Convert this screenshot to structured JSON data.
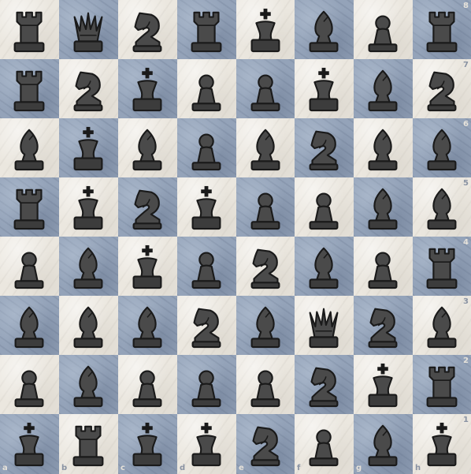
{
  "board": {
    "files": [
      "a",
      "b",
      "c",
      "d",
      "e",
      "f",
      "g",
      "h"
    ],
    "ranks": [
      "8",
      "7",
      "6",
      "5",
      "4",
      "3",
      "2",
      "1"
    ],
    "colors": {
      "light_square": "#ebe7df",
      "dark_square": "#94a3b9",
      "piece_fill": "#4a4a4a",
      "piece_outline": "#1a1a1a"
    },
    "piece_color": "black",
    "position": [
      [
        "rook",
        "queen",
        "knight",
        "rook",
        "king",
        "bishop",
        "pawn",
        "rook"
      ],
      [
        "rook",
        "knight",
        "king",
        "pawn",
        "pawn",
        "king",
        "bishop",
        "knight"
      ],
      [
        "bishop",
        "king",
        "bishop",
        "pawn",
        "bishop",
        "knight",
        "bishop",
        "bishop"
      ],
      [
        "rook",
        "king",
        "knight",
        "king",
        "pawn",
        "pawn",
        "bishop",
        "bishop"
      ],
      [
        "pawn",
        "bishop",
        "king",
        "pawn",
        "knight",
        "bishop",
        "pawn",
        "rook"
      ],
      [
        "bishop",
        "bishop",
        "bishop",
        "knight",
        "bishop",
        "queen",
        "knight",
        "bishop"
      ],
      [
        "pawn",
        "bishop",
        "pawn",
        "pawn",
        "pawn",
        "knight",
        "king",
        "rook"
      ],
      [
        "king",
        "rook",
        "king",
        "king",
        "knight",
        "pawn",
        "bishop",
        "king"
      ]
    ]
  }
}
